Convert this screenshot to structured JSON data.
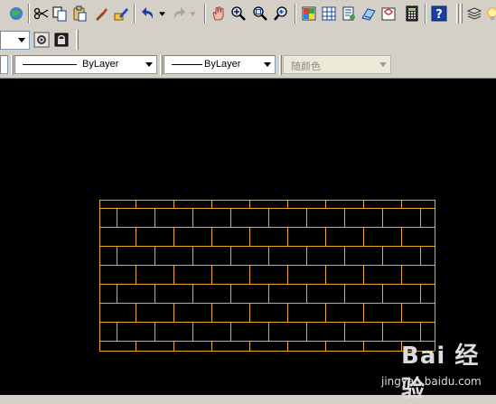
{
  "toolbar_standard": {
    "icons": [
      "publish-icon",
      "cut-icon",
      "copy-icon",
      "paste-icon",
      "match-properties-icon",
      "block-editor-icon",
      "undo-icon",
      "redo-icon",
      "pan-icon",
      "zoom-realtime-icon",
      "zoom-window-icon",
      "zoom-previous-icon",
      "properties-icon",
      "design-center-icon",
      "tool-palettes-icon",
      "sheet-set-icon",
      "markup-icon",
      "calculator-icon",
      "help-icon",
      "layer-manager-icon",
      "layer-state-icon"
    ]
  },
  "workspace_combo": {
    "value": ""
  },
  "properties": {
    "color_combo": "",
    "linetype_combo": "ByLayer",
    "lineweight_combo": "ByLayer",
    "plotstyle_combo": "随颜色"
  },
  "colors": {
    "toolbar_bg": "#d4d0c8",
    "canvas_bg": "#000000",
    "brick_line": "#f0a830"
  },
  "watermark": {
    "logo": "Bai 经验",
    "url": "jingyan.baidu.com"
  }
}
